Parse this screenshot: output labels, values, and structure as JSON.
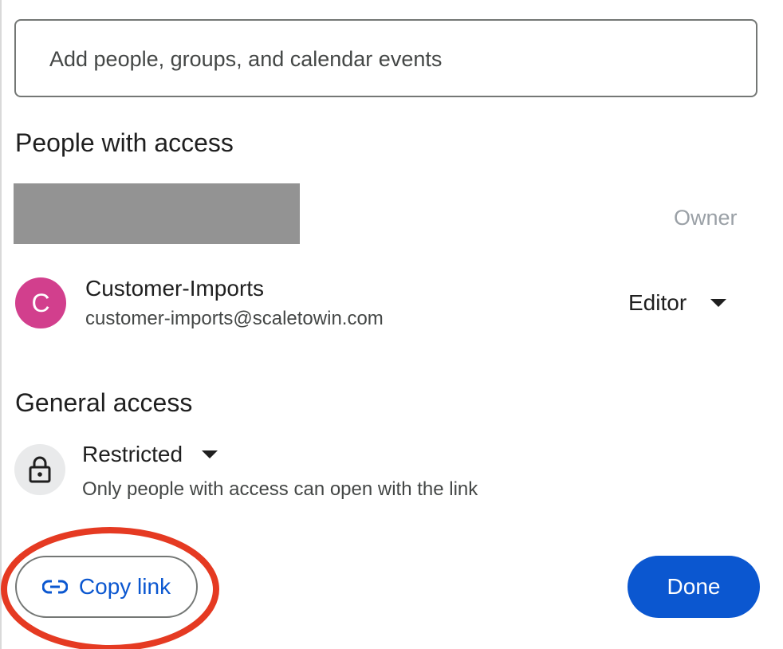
{
  "search": {
    "placeholder": "Add people, groups, and calendar events"
  },
  "people_section": {
    "title": "People with access",
    "owner": {
      "role": "Owner"
    },
    "members": [
      {
        "avatar_letter": "C",
        "name": "Customer-Imports",
        "email": "customer-imports@scaletowin.com",
        "role": "Editor"
      }
    ]
  },
  "general_access": {
    "title": "General access",
    "setting": "Restricted",
    "description": "Only people with access can open with the link"
  },
  "footer": {
    "copy_link_label": "Copy link",
    "done_label": "Done"
  },
  "colors": {
    "primary": "#0b57d0",
    "avatar": "#d23f8d",
    "highlight": "#e53a22",
    "redaction": "#939393"
  },
  "icons": {
    "lock": "lock-icon",
    "link": "link-icon",
    "caret": "caret-down-icon"
  }
}
